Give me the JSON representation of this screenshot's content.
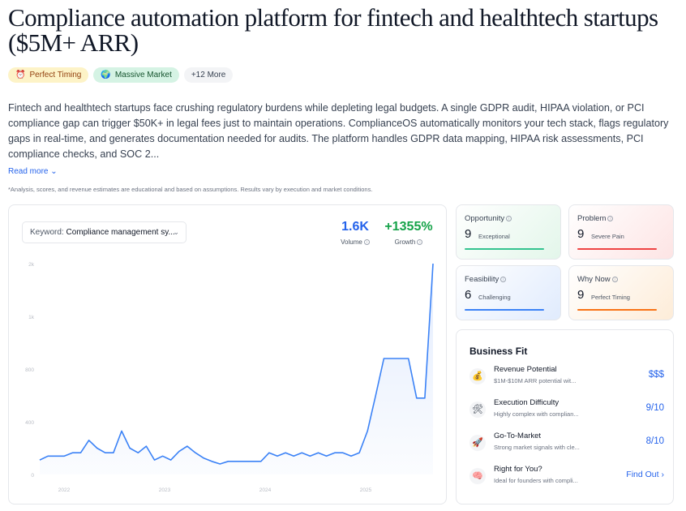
{
  "title": "Compliance automation platform for fintech and healthtech startups ($5M+ ARR)",
  "badges": [
    {
      "icon": "alarm-clock-icon",
      "label": "Perfect Timing"
    },
    {
      "icon": "globe-icon",
      "label": "Massive Market"
    },
    {
      "label": "+12 More"
    }
  ],
  "description": "Fintech and healthtech startups face crushing regulatory burdens while depleting legal budgets. A single GDPR audit, HIPAA violation, or PCI compliance gap can trigger $50K+ in legal fees just to maintain operations. ComplianceOS automatically monitors your tech stack, flags regulatory gaps in real-time, and generates documentation needed for audits. The platform handles GDPR data mapping, HIPAA risk assessments, PCI compliance checks, and SOC 2...",
  "read_more": "Read more",
  "disclaimer": "*Analysis, scores, and revenue estimates are educational and based on assumptions. Results vary by execution and market conditions.",
  "keyword": {
    "label": "Keyword:",
    "value": "Compliance management sy..."
  },
  "stats": {
    "volume": "1.6K",
    "volume_label": "Volume",
    "growth": "+1355%",
    "growth_label": "Growth"
  },
  "chart_data": {
    "type": "area",
    "y_ticks": [
      "2k",
      "1k",
      "800",
      "400",
      "0"
    ],
    "x_ticks": [
      "2022",
      "2023",
      "2024",
      "2025"
    ],
    "values": [
      110,
      140,
      140,
      140,
      165,
      165,
      260,
      200,
      165,
      165,
      330,
      200,
      165,
      215,
      110,
      140,
      110,
      175,
      215,
      165,
      125,
      100,
      80,
      100,
      100,
      100,
      100,
      100,
      165,
      140,
      165,
      140,
      165,
      140,
      165,
      140,
      165,
      165,
      140,
      165,
      330,
      600,
      880,
      880,
      880,
      880,
      580,
      580,
      1600
    ],
    "color": "#3b82f6",
    "fill": "#e3ecfd"
  },
  "metrics": {
    "opportunity": {
      "title": "Opportunity",
      "score": "9",
      "label": "Exceptional"
    },
    "problem": {
      "title": "Problem",
      "score": "9",
      "label": "Severe Pain"
    },
    "feasibility": {
      "title": "Feasibility",
      "score": "6",
      "label": "Challenging"
    },
    "why_now": {
      "title": "Why Now",
      "score": "9",
      "label": "Perfect Timing"
    }
  },
  "fit": {
    "title": "Business Fit",
    "rows": [
      {
        "icon": "money-bag-icon",
        "title": "Revenue Potential",
        "sub": "$1M-$10M ARR potential wit...",
        "value": "$$$"
      },
      {
        "icon": "tools-icon",
        "title": "Execution Difficulty",
        "sub": "Highly complex with complian...",
        "value": "9/10"
      },
      {
        "icon": "rocket-icon",
        "title": "Go-To-Market",
        "sub": "Strong market signals with cle...",
        "value": "8/10"
      },
      {
        "icon": "brain-icon",
        "title": "Right for You?",
        "sub": "Ideal for founders with compli...",
        "value": "Find Out"
      }
    ]
  }
}
